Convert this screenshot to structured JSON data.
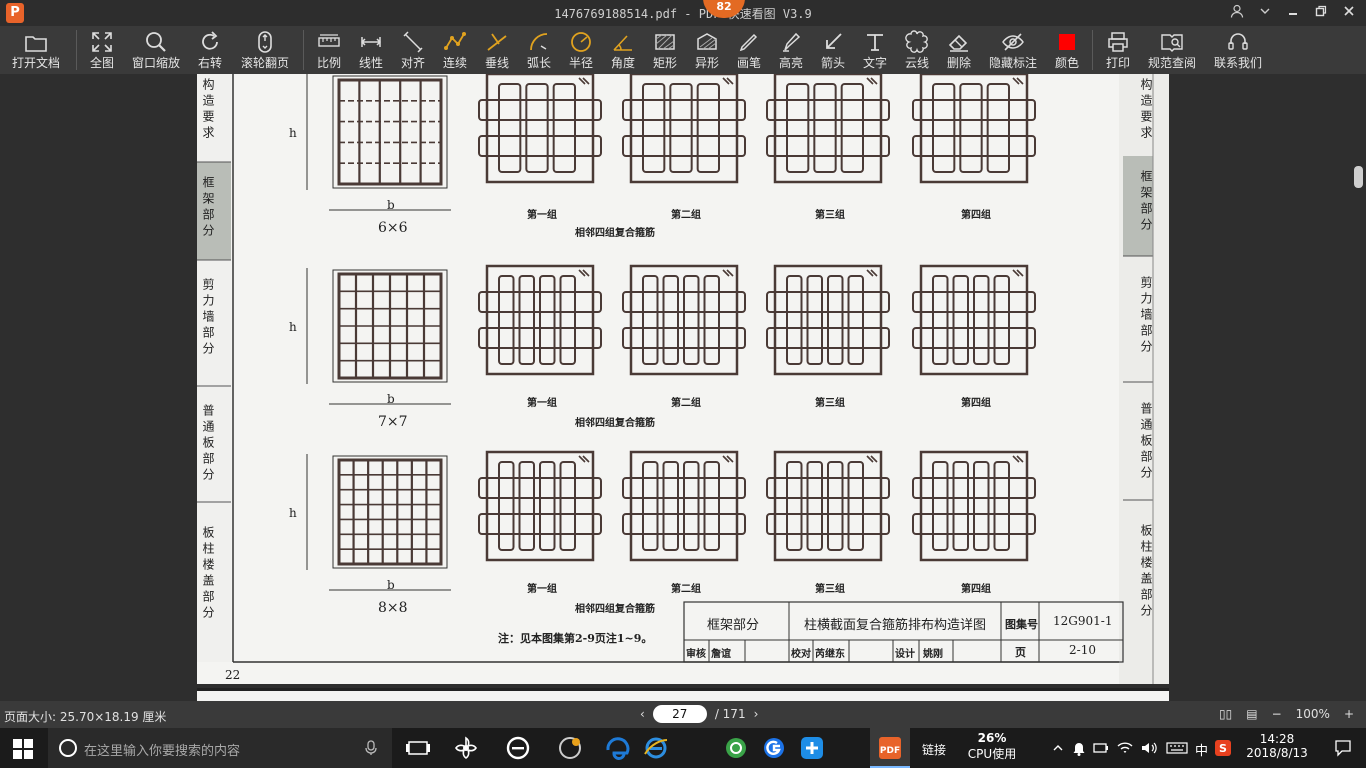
{
  "window": {
    "title": "1476769188514.pdf - PDF 快速看图 V3.9",
    "logo_letter": "P",
    "badge_count": "82"
  },
  "toolbar": [
    {
      "label": "打开文档",
      "icon": "folder-icon"
    },
    {
      "label": "全图",
      "icon": "fit-all-icon"
    },
    {
      "label": "窗口缩放",
      "icon": "zoom-window-icon"
    },
    {
      "label": "右转",
      "icon": "rotate-right-icon"
    },
    {
      "label": "滚轮翻页",
      "icon": "mouse-wheel-icon"
    },
    {
      "label": "比例",
      "icon": "scale-ruler-icon"
    },
    {
      "label": "线性",
      "icon": "linear-measure-icon"
    },
    {
      "label": "对齐",
      "icon": "aligned-measure-icon"
    },
    {
      "label": "连续",
      "icon": "continuous-measure-icon"
    },
    {
      "label": "垂线",
      "icon": "perpendicular-icon"
    },
    {
      "label": "弧长",
      "icon": "arc-length-icon"
    },
    {
      "label": "半径",
      "icon": "radius-icon"
    },
    {
      "label": "角度",
      "icon": "angle-icon"
    },
    {
      "label": "矩形",
      "icon": "rectangle-area-icon"
    },
    {
      "label": "异形",
      "icon": "polygon-area-icon"
    },
    {
      "label": "画笔",
      "icon": "pen-icon"
    },
    {
      "label": "高亮",
      "icon": "highlighter-icon"
    },
    {
      "label": "箭头",
      "icon": "arrow-icon"
    },
    {
      "label": "文字",
      "icon": "text-icon"
    },
    {
      "label": "云线",
      "icon": "cloud-line-icon"
    },
    {
      "label": "删除",
      "icon": "eraser-icon"
    },
    {
      "label": "隐藏标注",
      "icon": "hide-annotations-icon"
    },
    {
      "label": "颜色",
      "icon": "color-swatch-icon",
      "color": "#ff0000"
    },
    {
      "label": "打印",
      "icon": "printer-icon"
    },
    {
      "label": "规范查阅",
      "icon": "book-search-icon"
    },
    {
      "label": "联系我们",
      "icon": "support-icon"
    }
  ],
  "document": {
    "left_tabs": [
      "构造要求",
      "框架部分",
      "剪力墙部分",
      "普通板部分",
      "板柱楼盖部分"
    ],
    "right_tabs": [
      "构造要求",
      "框架部分",
      "剪力墙部分",
      "普通板部分",
      "板柱楼盖部分"
    ],
    "rows": [
      {
        "size": "6×6",
        "dim_b": "b",
        "dim_h": "h",
        "groups": [
          "第一组",
          "第二组",
          "第三组",
          "第四组"
        ],
        "caption": "相邻四组复合箍筋"
      },
      {
        "size": "7×7",
        "dim_b": "b",
        "dim_h": "h",
        "groups": [
          "第一组",
          "第二组",
          "第三组",
          "第四组"
        ],
        "caption": "相邻四组复合箍筋"
      },
      {
        "size": "8×8",
        "dim_b": "b",
        "dim_h": "h",
        "groups": [
          "第一组",
          "第二组",
          "第三组",
          "第四组"
        ],
        "caption": "相邻四组复合箍筋"
      }
    ],
    "note": "注：见本图集第2-9页注1~9。",
    "page_number": "22",
    "title_block": {
      "section": "框架部分",
      "drawing_title": "柱横截面复合箍筋排布构造详图",
      "atlas_label": "图集号",
      "atlas_no": "12G901-1",
      "review_label": "审核",
      "reviewer": "詹谊",
      "check_label": "校对",
      "checker": "芮继东",
      "design_label": "设计",
      "designer": "姚刚",
      "page_label": "页",
      "page_no": "2-10"
    }
  },
  "statusbar": {
    "page_size": "页面大小: 25.70×18.19 厘米",
    "current_page": "27",
    "total_pages": "/ 171",
    "zoom": "100%"
  },
  "taskbar": {
    "search_placeholder": "在这里输入你要搜索的内容",
    "active_app_label": "链接",
    "cpu_percent": "26%",
    "cpu_label": "CPU使用",
    "ime": "中",
    "time": "14:28",
    "date": "2018/8/13"
  }
}
